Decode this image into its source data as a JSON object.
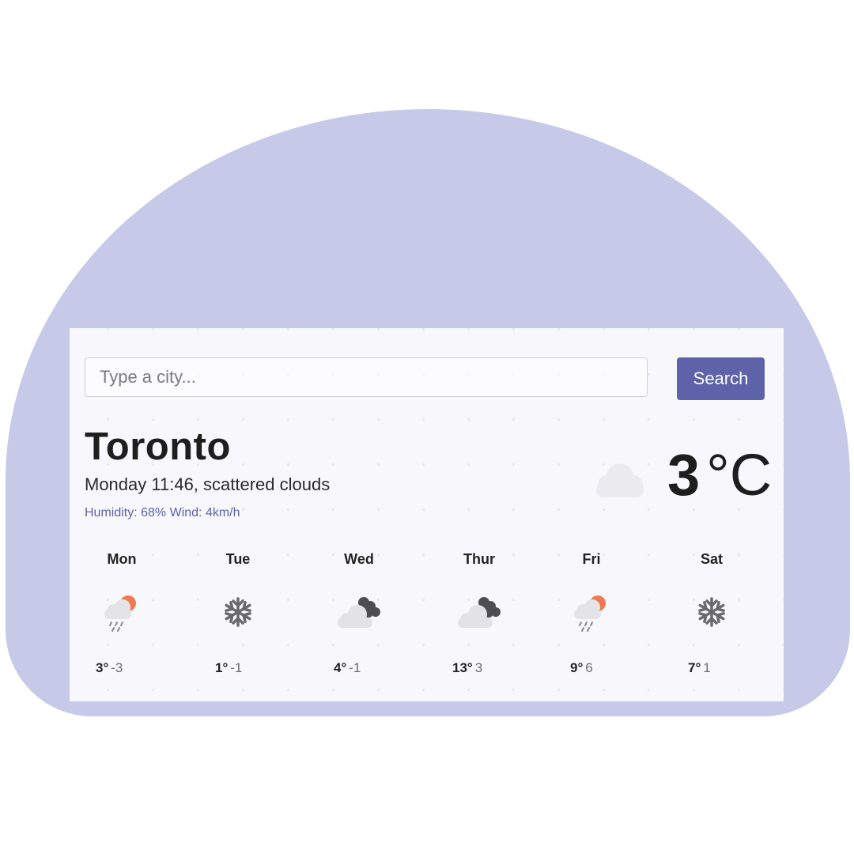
{
  "search": {
    "placeholder": "Type a city...",
    "button_label": "Search"
  },
  "current": {
    "city": "Toronto",
    "description": "Monday 11:46, scattered clouds",
    "details": "Humidity: 68% Wind: 4km/h",
    "temperature": "3",
    "unit": "°C",
    "icon": "cloud-icon"
  },
  "forecast": [
    {
      "day": "Mon",
      "high": "3°",
      "low": "-3",
      "icon": "rain-sun-icon"
    },
    {
      "day": "Tue",
      "high": "1°",
      "low": "-1",
      "icon": "snowflake-icon"
    },
    {
      "day": "Wed",
      "high": "4°",
      "low": "-1",
      "icon": "broken-clouds-icon"
    },
    {
      "day": "Thur",
      "high": "13°",
      "low": "3",
      "icon": "broken-clouds-icon"
    },
    {
      "day": "Fri",
      "high": "9°",
      "low": "6",
      "icon": "rain-sun-icon"
    },
    {
      "day": "Sat",
      "high": "7°",
      "low": "1",
      "icon": "snowflake-icon"
    }
  ],
  "colors": {
    "background_shape": "#c6c9e8",
    "accent": "#5e62a8",
    "card": "#f8f8fc",
    "sun": "#ee7a52"
  }
}
